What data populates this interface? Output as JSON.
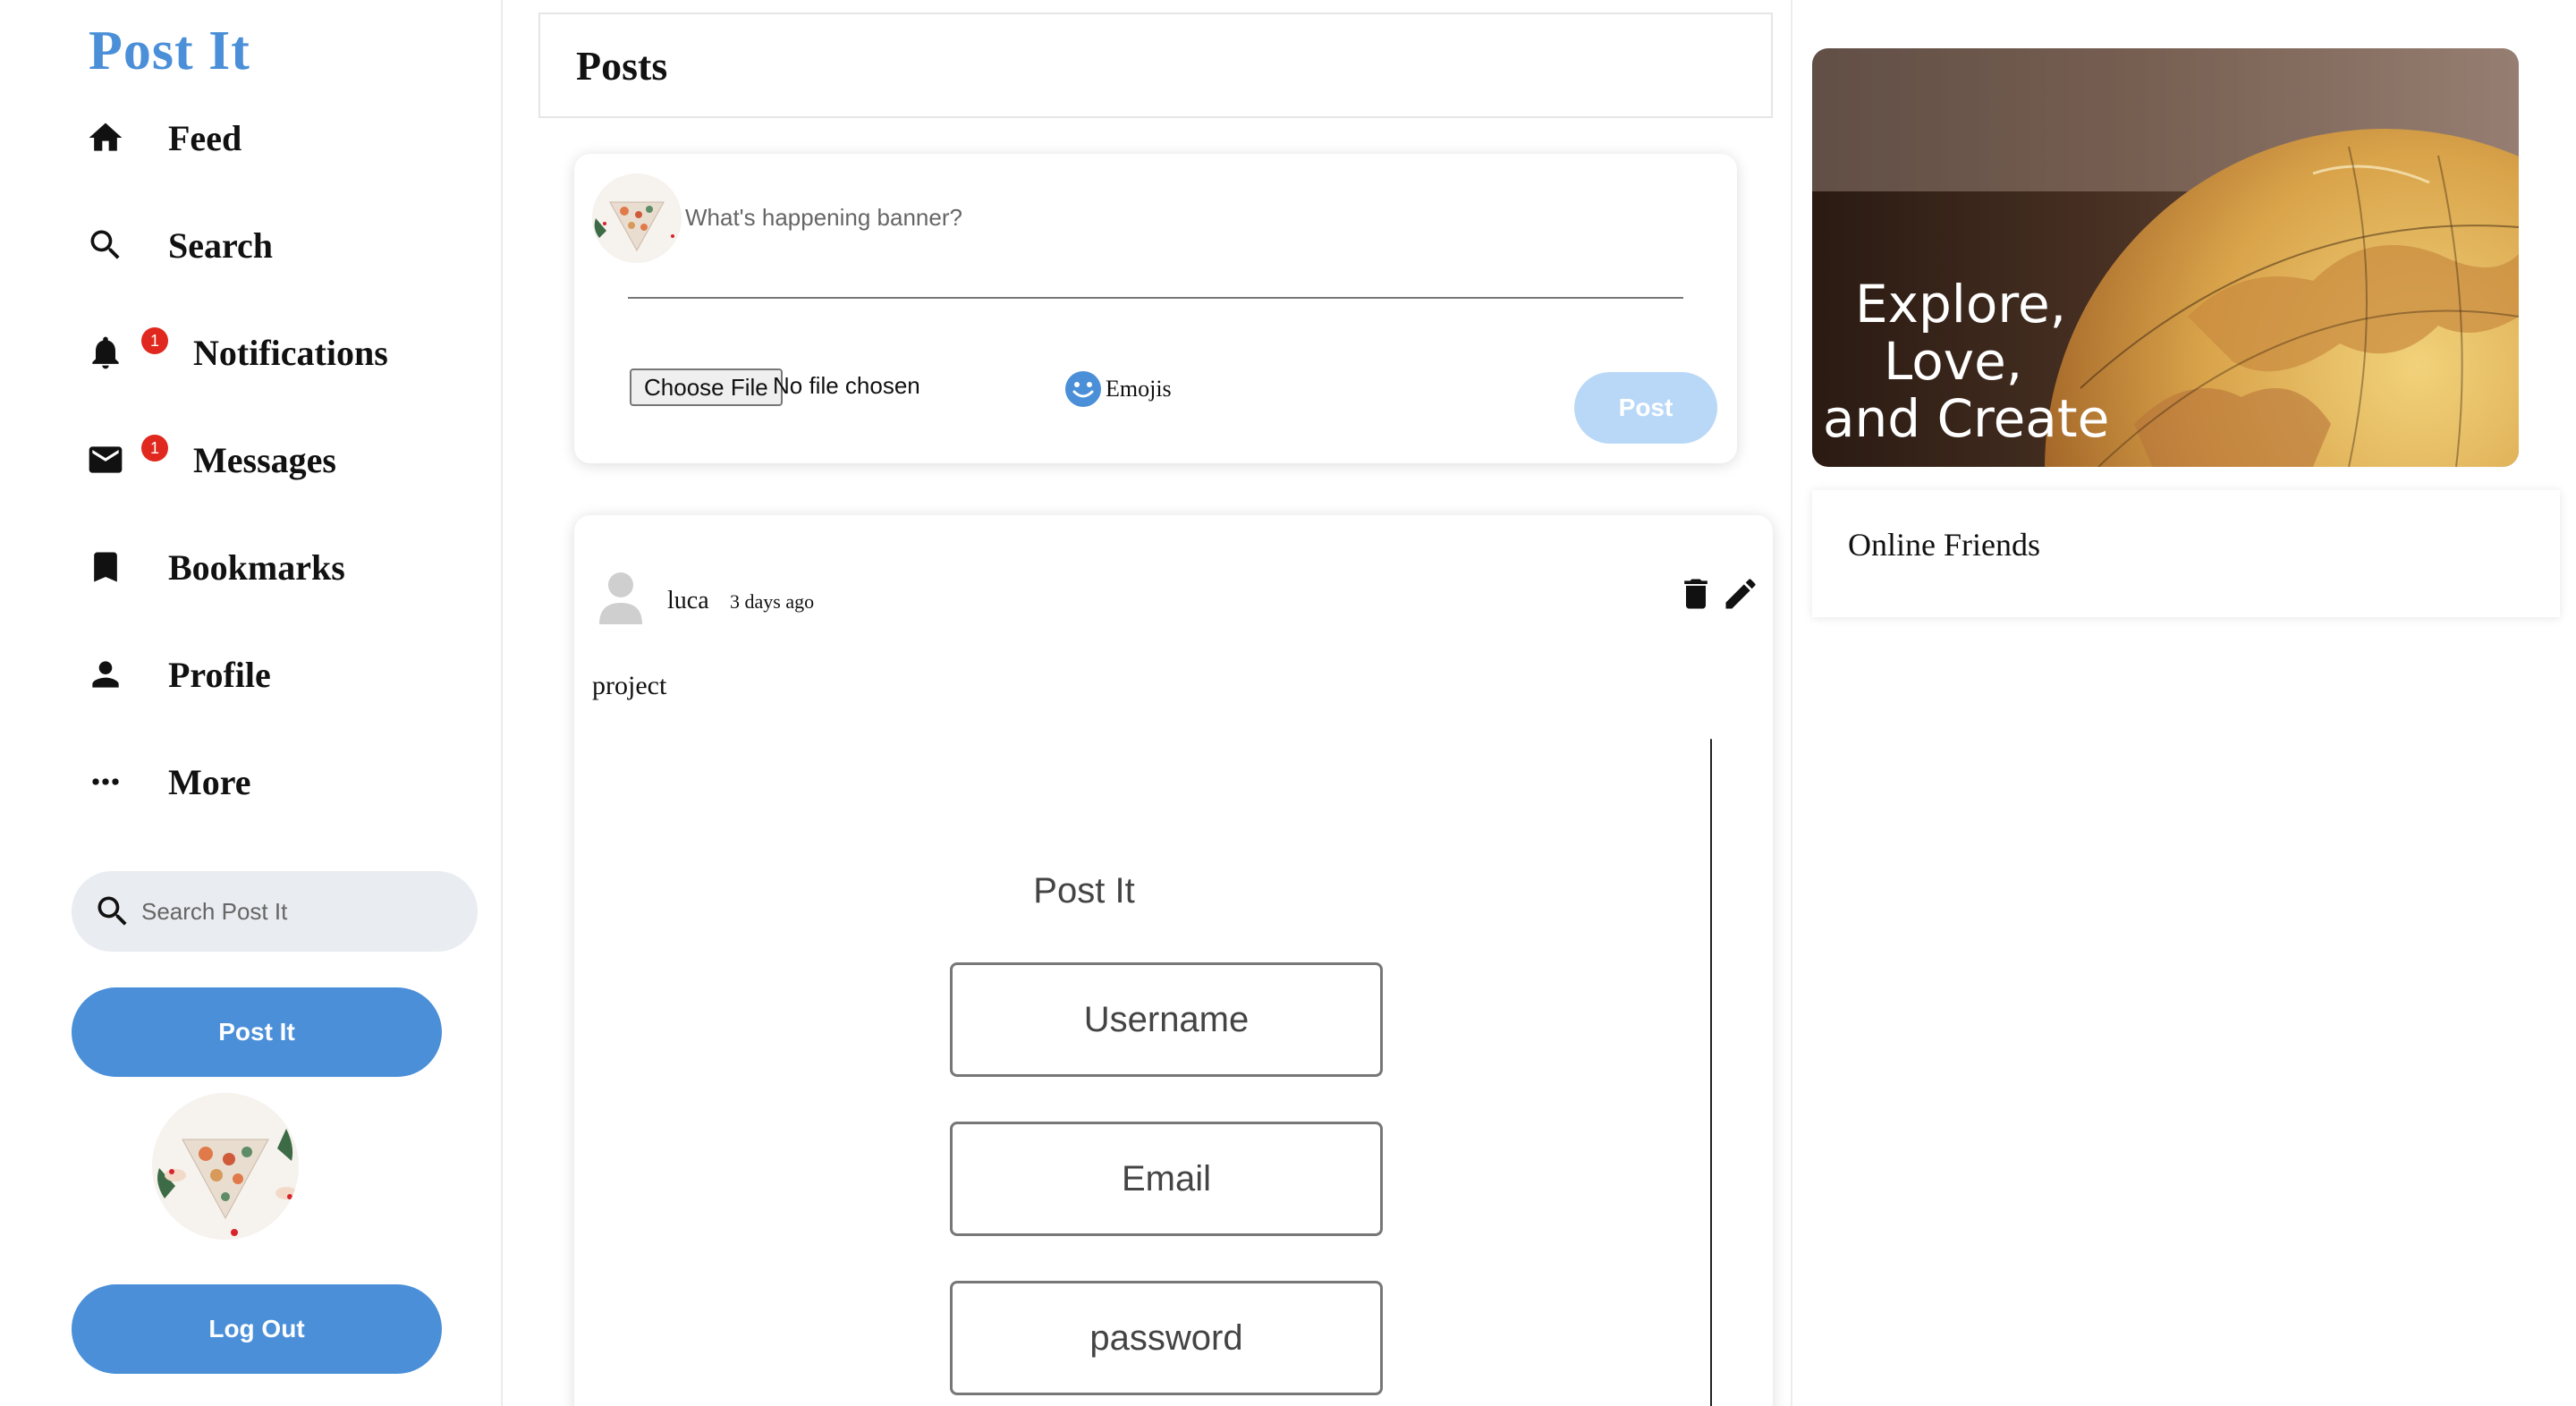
{
  "sidebar": {
    "brand": "Post It",
    "nav": [
      {
        "label": "Feed",
        "icon": "home-icon"
      },
      {
        "label": "Search",
        "icon": "search-icon"
      },
      {
        "label": "Notifications",
        "icon": "bell-icon",
        "badge": "1"
      },
      {
        "label": "Messages",
        "icon": "mail-icon",
        "badge": "1"
      },
      {
        "label": "Bookmarks",
        "icon": "bookmark-icon"
      },
      {
        "label": "Profile",
        "icon": "person-icon"
      },
      {
        "label": "More",
        "icon": "more-horizontal-icon"
      }
    ],
    "search_placeholder": "Search Post It",
    "post_button": "Post It",
    "logout_button": "Log Out"
  },
  "main": {
    "title": "Posts",
    "composer": {
      "placeholder": "What's happening banner?",
      "file_button": "Choose File",
      "file_status": "No file chosen",
      "emojis_label": "Emojis",
      "post_button": "Post"
    },
    "post": {
      "author": "luca",
      "time": "3 days ago",
      "text": "project",
      "embed": {
        "title": "Post It",
        "fields": [
          "Username",
          "Email",
          "password"
        ]
      }
    }
  },
  "right": {
    "banner_lines": [
      "Explore,",
      "Love,",
      "and Create"
    ],
    "online_friends_title": "Online Friends"
  },
  "colors": {
    "brand": "#4a8fd8",
    "button_primary": "#4a8fd8",
    "button_disabled": "#b9d8f7",
    "badge": "#e0281e",
    "search_bg": "#e9ecf0"
  }
}
